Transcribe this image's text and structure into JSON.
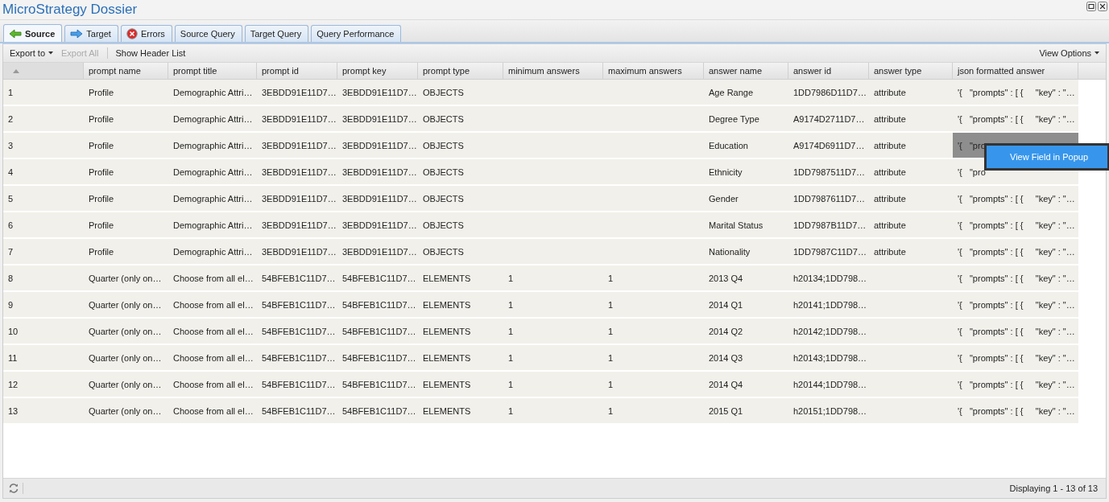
{
  "window": {
    "title": "MicroStrategy Dossier"
  },
  "tabs": [
    {
      "label": "Source",
      "selected": true
    },
    {
      "label": "Target",
      "selected": false
    },
    {
      "label": "Errors",
      "selected": false
    },
    {
      "label": "Source Query",
      "selected": false
    },
    {
      "label": "Target Query",
      "selected": false
    },
    {
      "label": "Query Performance",
      "selected": false
    }
  ],
  "toolbar": {
    "export_to": "Export to",
    "export_all": {
      "label": "Export All",
      "disabled": true
    },
    "show_header_list": "Show Header List",
    "view_options": "View Options"
  },
  "table": {
    "columns": [
      "prompt name",
      "prompt title",
      "prompt id",
      "prompt key",
      "prompt type",
      "minimum answers",
      "maximum answers",
      "answer name",
      "answer id",
      "answer type",
      "json formatted answer"
    ],
    "rows": [
      {
        "number": "1",
        "selected": false,
        "cells": [
          "Profile",
          "Demographic Attri…",
          "3EBDD91E11D7…",
          "3EBDD91E11D7…",
          "OBJECTS",
          null,
          null,
          "Age Range",
          "1DD7986D11D7…",
          "attribute",
          "'{   \"prompts\" : [ {     \"key\" : \"…"
        ]
      },
      {
        "number": "2",
        "selected": false,
        "cells": [
          "Profile",
          "Demographic Attri…",
          "3EBDD91E11D7…",
          "3EBDD91E11D7…",
          "OBJECTS",
          null,
          null,
          "Degree Type",
          "A9174D2711D7…",
          "attribute",
          "'{   \"prompts\" : [ {     \"key\" : \"…"
        ]
      },
      {
        "number": "3",
        "selected": true,
        "cells": [
          "Profile",
          "Demographic Attri…",
          "3EBDD91E11D7…",
          "3EBDD91E11D7…",
          "OBJECTS",
          null,
          null,
          "Education",
          "A9174D6911D7…",
          "attribute",
          "'{   \"pro"
        ]
      },
      {
        "number": "4",
        "selected": false,
        "cells": [
          "Profile",
          "Demographic Attri…",
          "3EBDD91E11D7…",
          "3EBDD91E11D7…",
          "OBJECTS",
          null,
          null,
          "Ethnicity",
          "1DD7987511D7…",
          "attribute",
          "'{   \"pro"
        ]
      },
      {
        "number": "5",
        "selected": false,
        "cells": [
          "Profile",
          "Demographic Attri…",
          "3EBDD91E11D7…",
          "3EBDD91E11D7…",
          "OBJECTS",
          null,
          null,
          "Gender",
          "1DD7987611D7…",
          "attribute",
          "'{   \"prompts\" : [ {     \"key\" : \"…"
        ]
      },
      {
        "number": "6",
        "selected": false,
        "cells": [
          "Profile",
          "Demographic Attri…",
          "3EBDD91E11D7…",
          "3EBDD91E11D7…",
          "OBJECTS",
          null,
          null,
          "Marital Status",
          "1DD7987B11D7…",
          "attribute",
          "'{   \"prompts\" : [ {     \"key\" : \"…"
        ]
      },
      {
        "number": "7",
        "selected": false,
        "cells": [
          "Profile",
          "Demographic Attri…",
          "3EBDD91E11D7…",
          "3EBDD91E11D7…",
          "OBJECTS",
          null,
          null,
          "Nationality",
          "1DD7987C11D7…",
          "attribute",
          "'{   \"prompts\" : [ {     \"key\" : \"…"
        ]
      },
      {
        "number": "8",
        "selected": false,
        "cells": [
          "Quarter (only on…",
          "Choose from all el…",
          "54BFEB1C11D7…",
          "54BFEB1C11D7…",
          "ELEMENTS",
          "1",
          "1",
          "2013 Q4",
          "h20134;1DD798…",
          null,
          "'{   \"prompts\" : [ {     \"key\" : \"…"
        ]
      },
      {
        "number": "9",
        "selected": false,
        "cells": [
          "Quarter (only on…",
          "Choose from all el…",
          "54BFEB1C11D7…",
          "54BFEB1C11D7…",
          "ELEMENTS",
          "1",
          "1",
          "2014 Q1",
          "h20141;1DD798…",
          null,
          "'{   \"prompts\" : [ {     \"key\" : \"…"
        ]
      },
      {
        "number": "10",
        "selected": false,
        "cells": [
          "Quarter (only on…",
          "Choose from all el…",
          "54BFEB1C11D7…",
          "54BFEB1C11D7…",
          "ELEMENTS",
          "1",
          "1",
          "2014 Q2",
          "h20142;1DD798…",
          null,
          "'{   \"prompts\" : [ {     \"key\" : \"…"
        ]
      },
      {
        "number": "11",
        "selected": false,
        "cells": [
          "Quarter (only on…",
          "Choose from all el…",
          "54BFEB1C11D7…",
          "54BFEB1C11D7…",
          "ELEMENTS",
          "1",
          "1",
          "2014 Q3",
          "h20143;1DD798…",
          null,
          "'{   \"prompts\" : [ {     \"key\" : \"…"
        ]
      },
      {
        "number": "12",
        "selected": false,
        "cells": [
          "Quarter (only on…",
          "Choose from all el…",
          "54BFEB1C11D7…",
          "54BFEB1C11D7…",
          "ELEMENTS",
          "1",
          "1",
          "2014 Q4",
          "h20144;1DD798…",
          null,
          "'{   \"prompts\" : [ {     \"key\" : \"…"
        ]
      },
      {
        "number": "13",
        "selected": false,
        "cells": [
          "Quarter (only on…",
          "Choose from all el…",
          "54BFEB1C11D7…",
          "54BFEB1C11D7…",
          "ELEMENTS",
          "1",
          "1",
          "2015 Q1",
          "h20151;1DD798…",
          null,
          "'{   \"prompts\" : [ {     \"key\" : \"…"
        ]
      }
    ]
  },
  "context_menu": {
    "items": [
      "View Field in Popup"
    ]
  },
  "status_bar": {
    "text": "Displaying 1 - 13 of 13"
  }
}
